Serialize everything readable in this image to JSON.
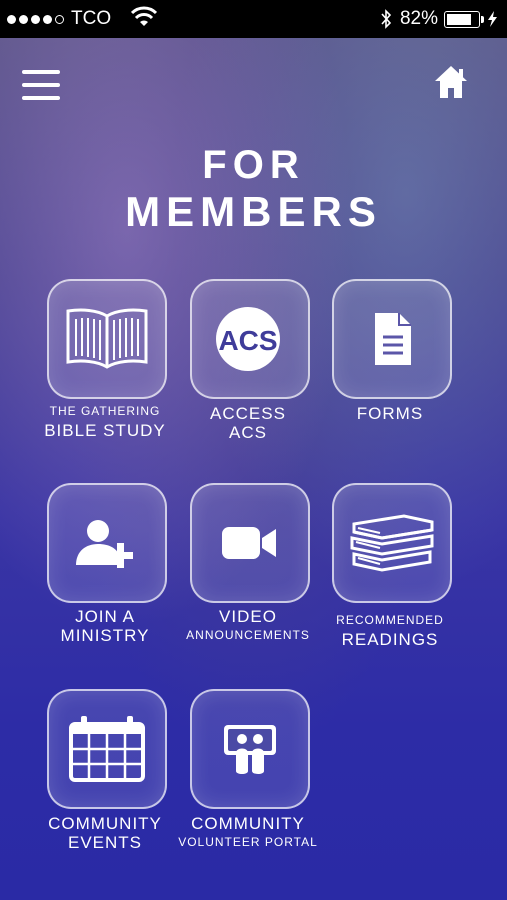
{
  "status_bar": {
    "carrier": "TCO",
    "battery": "82%"
  },
  "page": {
    "title_line1": "FOR",
    "title_line2": "MEMBERS"
  },
  "icons": {
    "menu": "hamburger-menu-icon",
    "home": "home-icon"
  },
  "tiles": [
    {
      "line1": "THE GATHERING",
      "line2": "BIBLE STUDY",
      "icon": "open-book-icon"
    },
    {
      "line1": "ACCESS",
      "line2": "ACS",
      "icon": "acs-logo-icon",
      "icon_text": "ACS"
    },
    {
      "line1": "FORMS",
      "line2": "",
      "icon": "document-icon"
    },
    {
      "line1": "JOIN A",
      "line2": "MINISTRY",
      "icon": "add-user-icon"
    },
    {
      "line1": "VIDEO",
      "line2": "ANNOUNCEMENTS",
      "icon": "video-camera-icon"
    },
    {
      "line1": "RECOMMENDED",
      "line2": "READINGS",
      "icon": "book-stack-icon"
    },
    {
      "line1": "COMMUNITY",
      "line2": "EVENTS",
      "icon": "calendar-icon"
    },
    {
      "line1": "COMMUNITY",
      "line2": "VOLUNTEER PORTAL",
      "icon": "volunteer-hands-icon"
    }
  ]
}
